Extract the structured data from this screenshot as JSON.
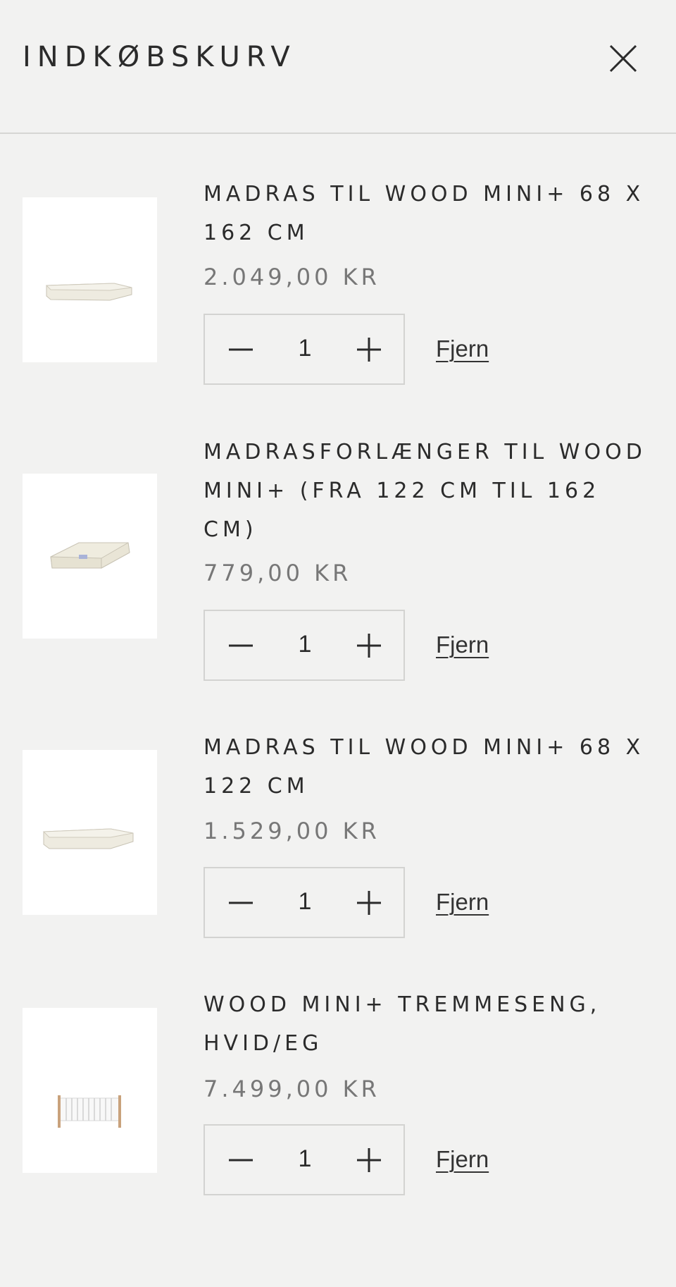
{
  "header": {
    "title": "INDKØBSKURV",
    "close_icon": "close-icon"
  },
  "cart": {
    "items": [
      {
        "name": "MADRAS TIL WOOD MINI+ 68 X 162 CM",
        "price": "2.049,00 KR",
        "quantity": "1",
        "remove_label": "Fjern",
        "image": "mattress-image"
      },
      {
        "name": "MADRASFORLÆNGER TIL WOOD MINI+ (FRA 122 CM TIL 162 CM)",
        "price": "779,00 KR",
        "quantity": "1",
        "remove_label": "Fjern",
        "image": "mattress-extension-image"
      },
      {
        "name": "MADRAS TIL WOOD MINI+ 68 X 122 CM",
        "price": "1.529,00 KR",
        "quantity": "1",
        "remove_label": "Fjern",
        "image": "mattress-image"
      },
      {
        "name": "WOOD MINI+ TREMMESENG, HVID/EG",
        "price": "7.499,00 KR",
        "quantity": "1",
        "remove_label": "Fjern",
        "image": "crib-image"
      }
    ]
  },
  "colors": {
    "background": "#f2f2f1",
    "text": "#2b2b2b",
    "price": "#777777",
    "border": "#d3d3d1"
  }
}
